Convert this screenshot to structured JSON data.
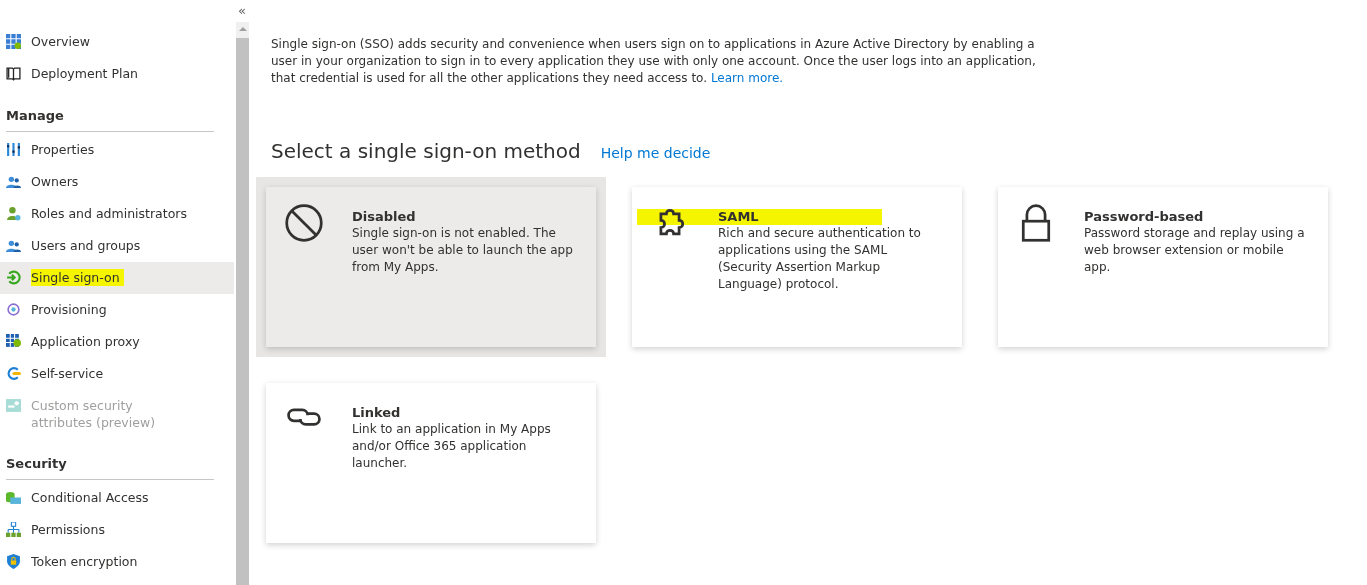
{
  "sidebar": {
    "collapse": "«",
    "items": [
      {
        "label": "Overview",
        "selected": false,
        "disabled": false,
        "highlighted": false
      },
      {
        "label": "Deployment Plan",
        "selected": false,
        "disabled": false,
        "highlighted": false
      }
    ],
    "sections": [
      {
        "title": "Manage",
        "items": [
          {
            "label": "Properties",
            "selected": false,
            "disabled": false,
            "highlighted": false
          },
          {
            "label": "Owners",
            "selected": false,
            "disabled": false,
            "highlighted": false
          },
          {
            "label": "Roles and administrators",
            "selected": false,
            "disabled": false,
            "highlighted": false
          },
          {
            "label": "Users and groups",
            "selected": false,
            "disabled": false,
            "highlighted": false
          },
          {
            "label": "Single sign-on",
            "selected": true,
            "disabled": false,
            "highlighted": true
          },
          {
            "label": "Provisioning",
            "selected": false,
            "disabled": false,
            "highlighted": false
          },
          {
            "label": "Application proxy",
            "selected": false,
            "disabled": false,
            "highlighted": false
          },
          {
            "label": "Self-service",
            "selected": false,
            "disabled": false,
            "highlighted": false
          },
          {
            "label": "Custom security attributes (preview)",
            "selected": false,
            "disabled": true,
            "highlighted": false
          }
        ]
      },
      {
        "title": "Security",
        "items": [
          {
            "label": "Conditional Access",
            "selected": false,
            "disabled": false,
            "highlighted": false
          },
          {
            "label": "Permissions",
            "selected": false,
            "disabled": false,
            "highlighted": false
          },
          {
            "label": "Token encryption",
            "selected": false,
            "disabled": false,
            "highlighted": false
          }
        ]
      }
    ]
  },
  "intro": {
    "text": "Single sign-on (SSO) adds security and convenience when users sign on to applications in Azure Active Directory by enabling a user in your organization to sign in to every application they use with only one account. Once the user logs into an application, that credential is used for all the other applications they need access to.",
    "link": "Learn more."
  },
  "heading": "Select a single sign-on method",
  "help_link": "Help me decide",
  "methods": [
    {
      "kind": "disabled",
      "title": "Disabled",
      "description": "Single sign-on is not enabled. The user won't be able to launch the app from My Apps.",
      "selected": true,
      "highlighted": false
    },
    {
      "kind": "saml",
      "title": "SAML",
      "description": "Rich and secure authentication to applications using the SAML (Security Assertion Markup Language) protocol.",
      "selected": false,
      "highlighted": true
    },
    {
      "kind": "password",
      "title": "Password-based",
      "description": "Password storage and replay using a web browser extension or mobile app.",
      "selected": false,
      "highlighted": false
    },
    {
      "kind": "linked",
      "title": "Linked",
      "description": "Link to an application in My Apps and/or Office 365 application launcher.",
      "selected": false,
      "highlighted": false
    }
  ]
}
